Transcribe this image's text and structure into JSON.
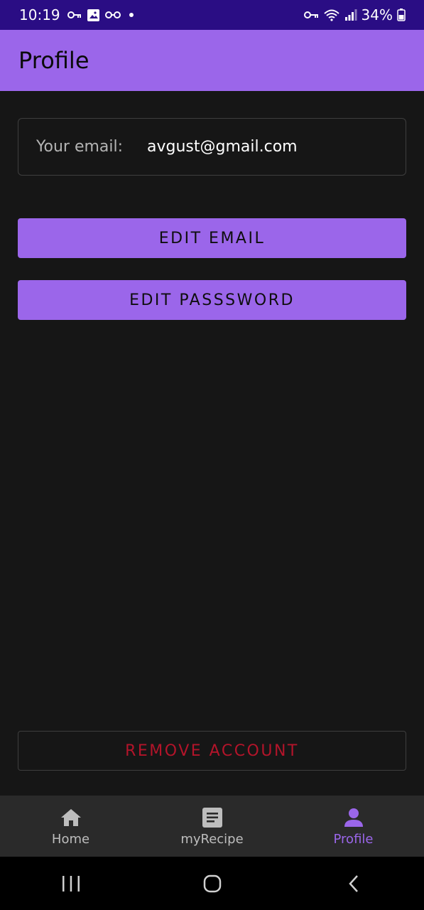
{
  "status_bar": {
    "time": "10:19",
    "battery": "34%",
    "left_icons": [
      "key-icon",
      "image-icon",
      "glasses-icon",
      "dot-icon"
    ],
    "right_icons": [
      "vpn-key-icon",
      "wifi-icon",
      "signal-icon",
      "battery-icon"
    ]
  },
  "app_bar": {
    "title": "Profile"
  },
  "email_card": {
    "label": "Your email:",
    "value": "avgust@gmail.com"
  },
  "buttons": {
    "edit_email": "EDIT EMAIL",
    "edit_password": "EDIT PASSSWORD",
    "remove_account": "REMOVE ACCOUNT"
  },
  "bottom_nav": {
    "items": [
      {
        "label": "Home",
        "icon": "home-icon",
        "active": false
      },
      {
        "label": "myRecipe",
        "icon": "document-icon",
        "active": false
      },
      {
        "label": "Profile",
        "icon": "person-icon",
        "active": true
      }
    ]
  },
  "system_nav": {
    "icons": [
      "recents-icon",
      "home-circle-icon",
      "back-icon"
    ]
  },
  "colors": {
    "status_bar": "#2a0d84",
    "accent": "#9b66ea",
    "background": "#161616",
    "danger": "#b3142a",
    "nav_background": "#2a2a2a"
  }
}
